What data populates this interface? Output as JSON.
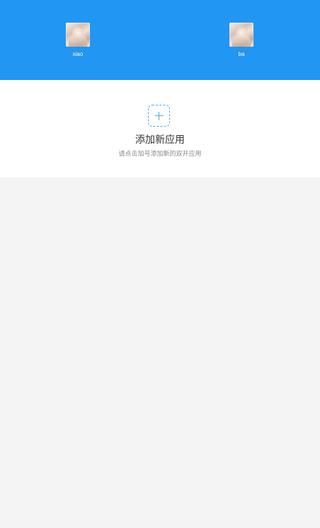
{
  "header": {
    "accounts": [
      {
        "name": "xiao",
        "icon": "avatar-photo"
      },
      {
        "name": "ba",
        "icon": "avatar-photo"
      }
    ],
    "background": "#2196f3"
  },
  "add_panel": {
    "icon": "plus-icon",
    "title": "添加新应用",
    "subtitle": "请点击加号添加新的双开应用",
    "accent": "#4aa8f0"
  }
}
